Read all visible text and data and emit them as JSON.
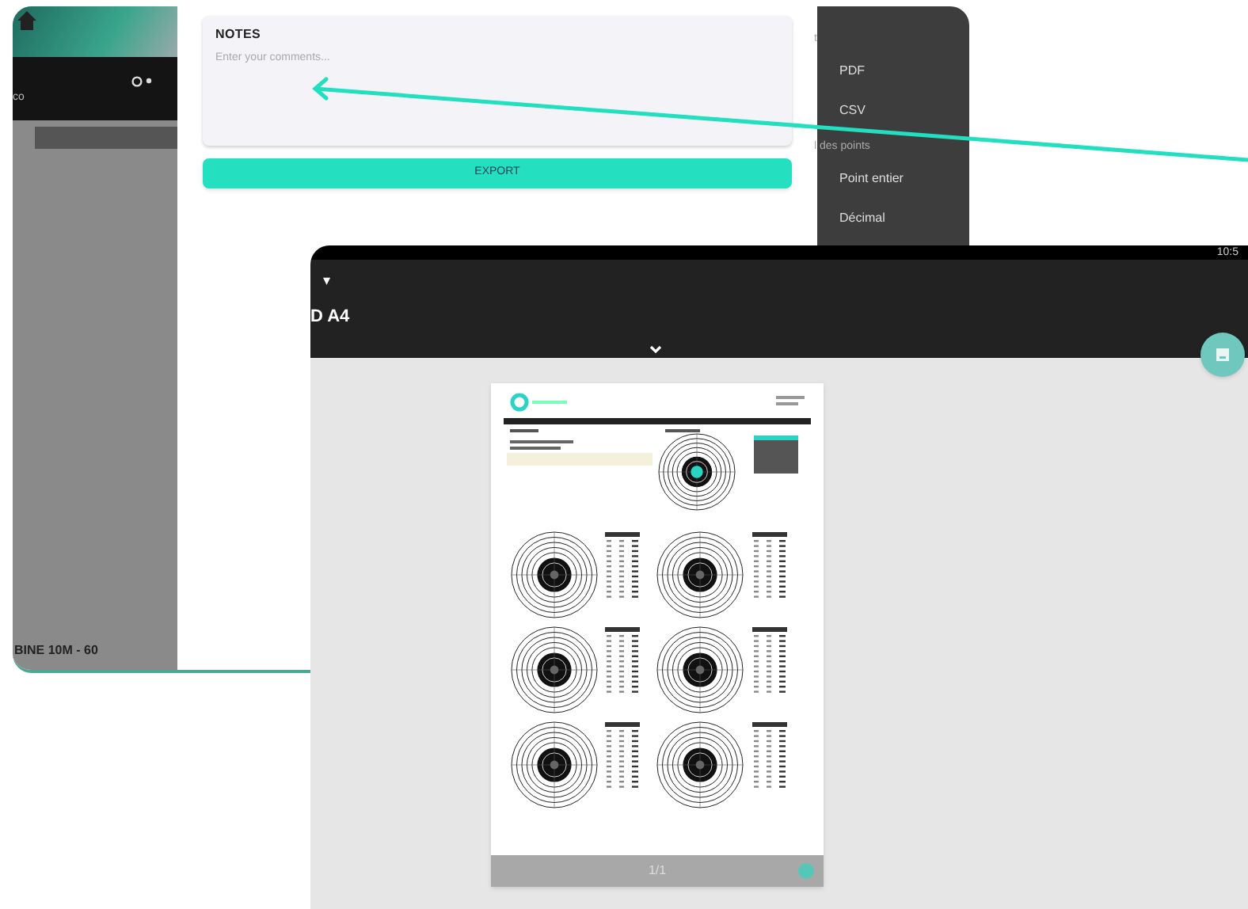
{
  "back_window": {
    "sidebar": {
      "cut_label": "co",
      "footer": "BINE 10M - 60"
    },
    "notes": {
      "title": "NOTES",
      "placeholder": "Enter your comments..."
    },
    "export_button": "EXPORT",
    "menu": [
      {
        "label": "t",
        "kind": "section"
      },
      {
        "label": "PDF",
        "kind": "option"
      },
      {
        "label": "CSV",
        "kind": "option"
      },
      {
        "label": "l des points",
        "kind": "section"
      },
      {
        "label": "Point entier",
        "kind": "option"
      },
      {
        "label": "Décimal",
        "kind": "option"
      }
    ]
  },
  "front_window": {
    "status_time": "10:5",
    "caret": "▾",
    "title": "D A4",
    "page_counter": "1/1"
  }
}
